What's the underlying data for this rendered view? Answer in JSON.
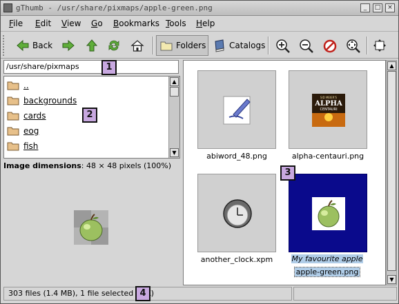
{
  "window": {
    "title": "gThumb - /usr/share/pixmaps/apple-green.png",
    "controls": [
      "_",
      "□",
      "×"
    ]
  },
  "menu": [
    "File",
    "Edit",
    "View",
    "Go",
    "Bookmarks",
    "Tools",
    "Help"
  ],
  "menu_mnemonics": [
    "F",
    "E",
    "V",
    "G",
    "B",
    "T",
    "H"
  ],
  "toolbar": {
    "back_label": "Back",
    "folders_label": "Folders",
    "catalogs_label": "Catalogs"
  },
  "path": "/usr/share/pixmaps",
  "dirs": [
    "..",
    "backgrounds",
    "cards",
    "eog",
    "fish"
  ],
  "image_info": {
    "label": "Image dimensions",
    "value": ": 48 × 48 pixels (100%)"
  },
  "thumbnails": [
    {
      "name": "abiword_48.png",
      "comment": ""
    },
    {
      "name": "alpha-centauri.png",
      "comment": ""
    },
    {
      "name": "another_clock.xpm",
      "comment": ""
    },
    {
      "name": "apple-green.png",
      "comment": "My favourite apple"
    }
  ],
  "alpha_icon_text": {
    "line1": "SID MEIER'S",
    "line2": "ALPHA",
    "line3": "CENTAURI"
  },
  "status": "303 files (1.4 MB), 1 file selected (4 K)",
  "markers": [
    "1",
    "2",
    "3",
    "4"
  ],
  "colors": {
    "selection": "#0a0a8c",
    "highlight": "#b0cde8",
    "marker": "#c8a8e0"
  }
}
